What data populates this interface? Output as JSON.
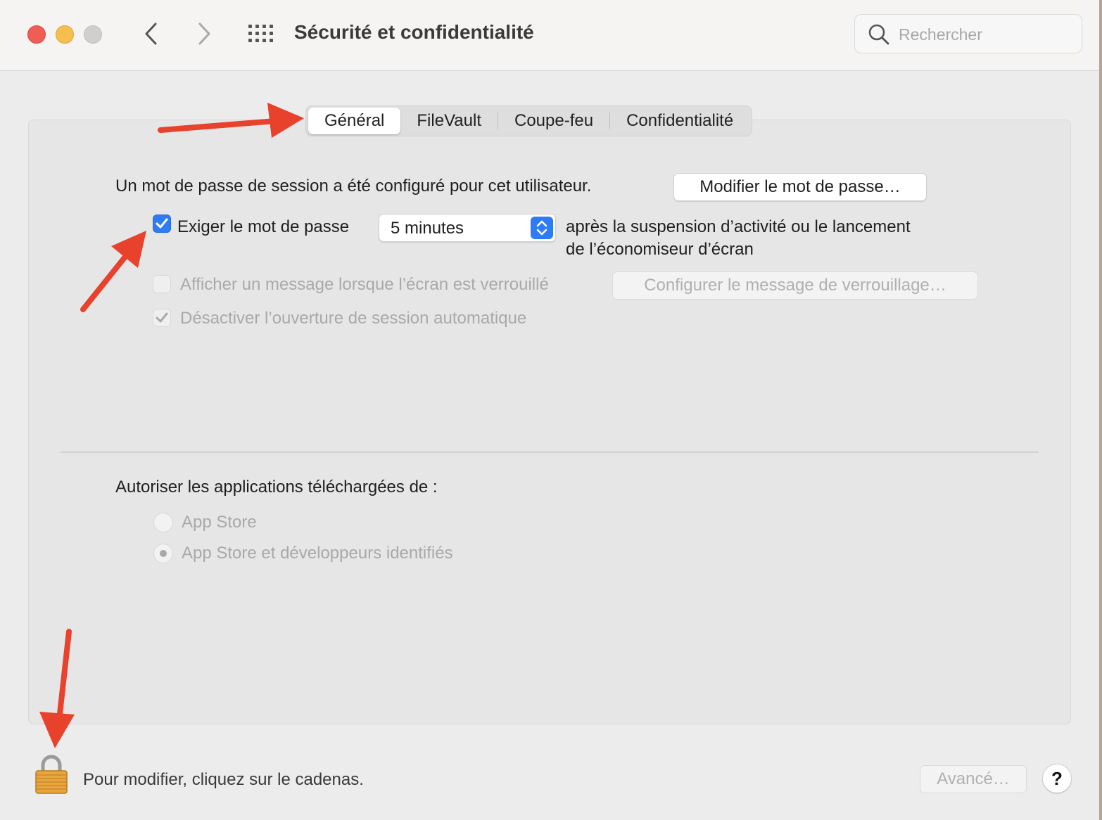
{
  "window": {
    "title": "Sécurité et confidentialité"
  },
  "toolbar": {
    "back_icon": "chevron-left-icon",
    "forward_icon": "chevron-right-icon",
    "grid_icon": "grid-icon"
  },
  "search": {
    "placeholder": "Rechercher",
    "icon": "search-icon"
  },
  "tabs": [
    {
      "label": "Général",
      "active": true
    },
    {
      "label": "FileVault",
      "active": false
    },
    {
      "label": "Coupe-feu",
      "active": false
    },
    {
      "label": "Confidentialité",
      "active": false
    }
  ],
  "general": {
    "password_status": "Un mot de passe de session a été configuré pour cet utilisateur.",
    "change_password_button": "Modifier le mot de passe…",
    "require_password": {
      "label": "Exiger le mot de passe",
      "checked": true,
      "delay_value": "5 minutes",
      "suffix_line1": "après la suspension d’activité ou le lancement",
      "suffix_line2": "de l’économiseur d’écran"
    },
    "show_message": {
      "label": "Afficher un message lorsque l’écran est verrouillé",
      "checked": false,
      "enabled": false,
      "button": "Configurer le message de verrouillage…"
    },
    "disable_autologin": {
      "label": "Désactiver l’ouverture de session automatique",
      "checked": true,
      "enabled": false
    }
  },
  "downloads": {
    "heading": "Autoriser les applications téléchargées de :",
    "options": [
      {
        "label": "App Store",
        "selected": false
      },
      {
        "label": "App Store et développeurs identifiés",
        "selected": true
      }
    ]
  },
  "footer": {
    "lock_text": "Pour modifier, cliquez sur le cadenas.",
    "advanced_button": "Avancé…",
    "help_label": "?"
  },
  "colors": {
    "accent": "#2f7bf6",
    "annotation_arrow": "#e8412c",
    "close": "#ee5e56",
    "minimize": "#f5be4f"
  }
}
